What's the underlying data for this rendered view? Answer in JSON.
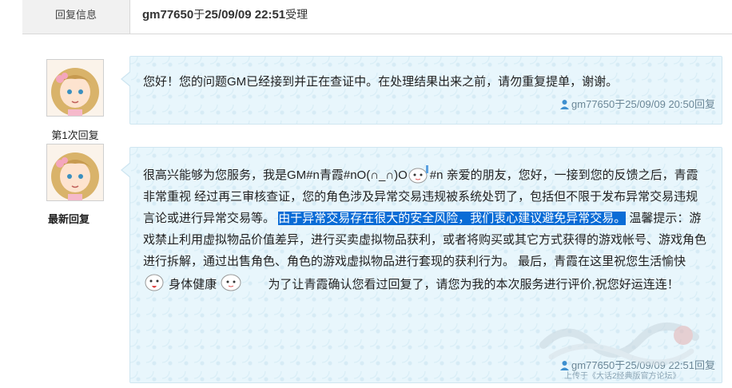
{
  "header": {
    "label": "回复信息",
    "gm": "gm77650",
    "at": "于",
    "datetime": "25/09/09 22:51",
    "status": "受理"
  },
  "replies": [
    {
      "index_label": "第1次回复",
      "message": "您好！您的问题GM已经接到并正在查证中。在处理结果出来之前，请勿重复提单，谢谢。",
      "meta": "gm77650于25/09/09 20:50回复"
    },
    {
      "index_label": "最新回复",
      "message_p1": "很高兴能够为您服务，我是GM#n青霞#nO(∩_∩)O",
      "message_p2": "#n    亲爱的朋友，您好，一接到您的反馈之后，青霞非常重视    经过再三审核查证，您的角色涉及异常交易违规被系统处罚了，包括但不限于发布异常交易违规言论或进行异常交易等。",
      "highlight": "由于异常交易存在很大的安全风险，我们衷心建议避免异常交易。",
      "message_p3": "   温馨提示：游戏禁止利用虚拟物品价值差异，进行买卖虚拟物品获利，或者将购买或其它方式获得的游戏帐号、游戏角色进行拆解，通过出售角色、角色的游戏虚拟物品进行套现的获利行为。    最后，青霞在这里祝您生活愉快",
      "message_p4": "身体健康",
      "message_p5": "为了让青霞确认您看过回复了，请您为我的本次服务进行评价,祝您好运连连！",
      "meta": "gm77650于25/09/09 22:51回复"
    }
  ],
  "watermark_caption": "上传于《大话2经典版官方论坛》",
  "icons": [
    "person-icon",
    "emoticon-icon",
    "avatar-icon"
  ]
}
